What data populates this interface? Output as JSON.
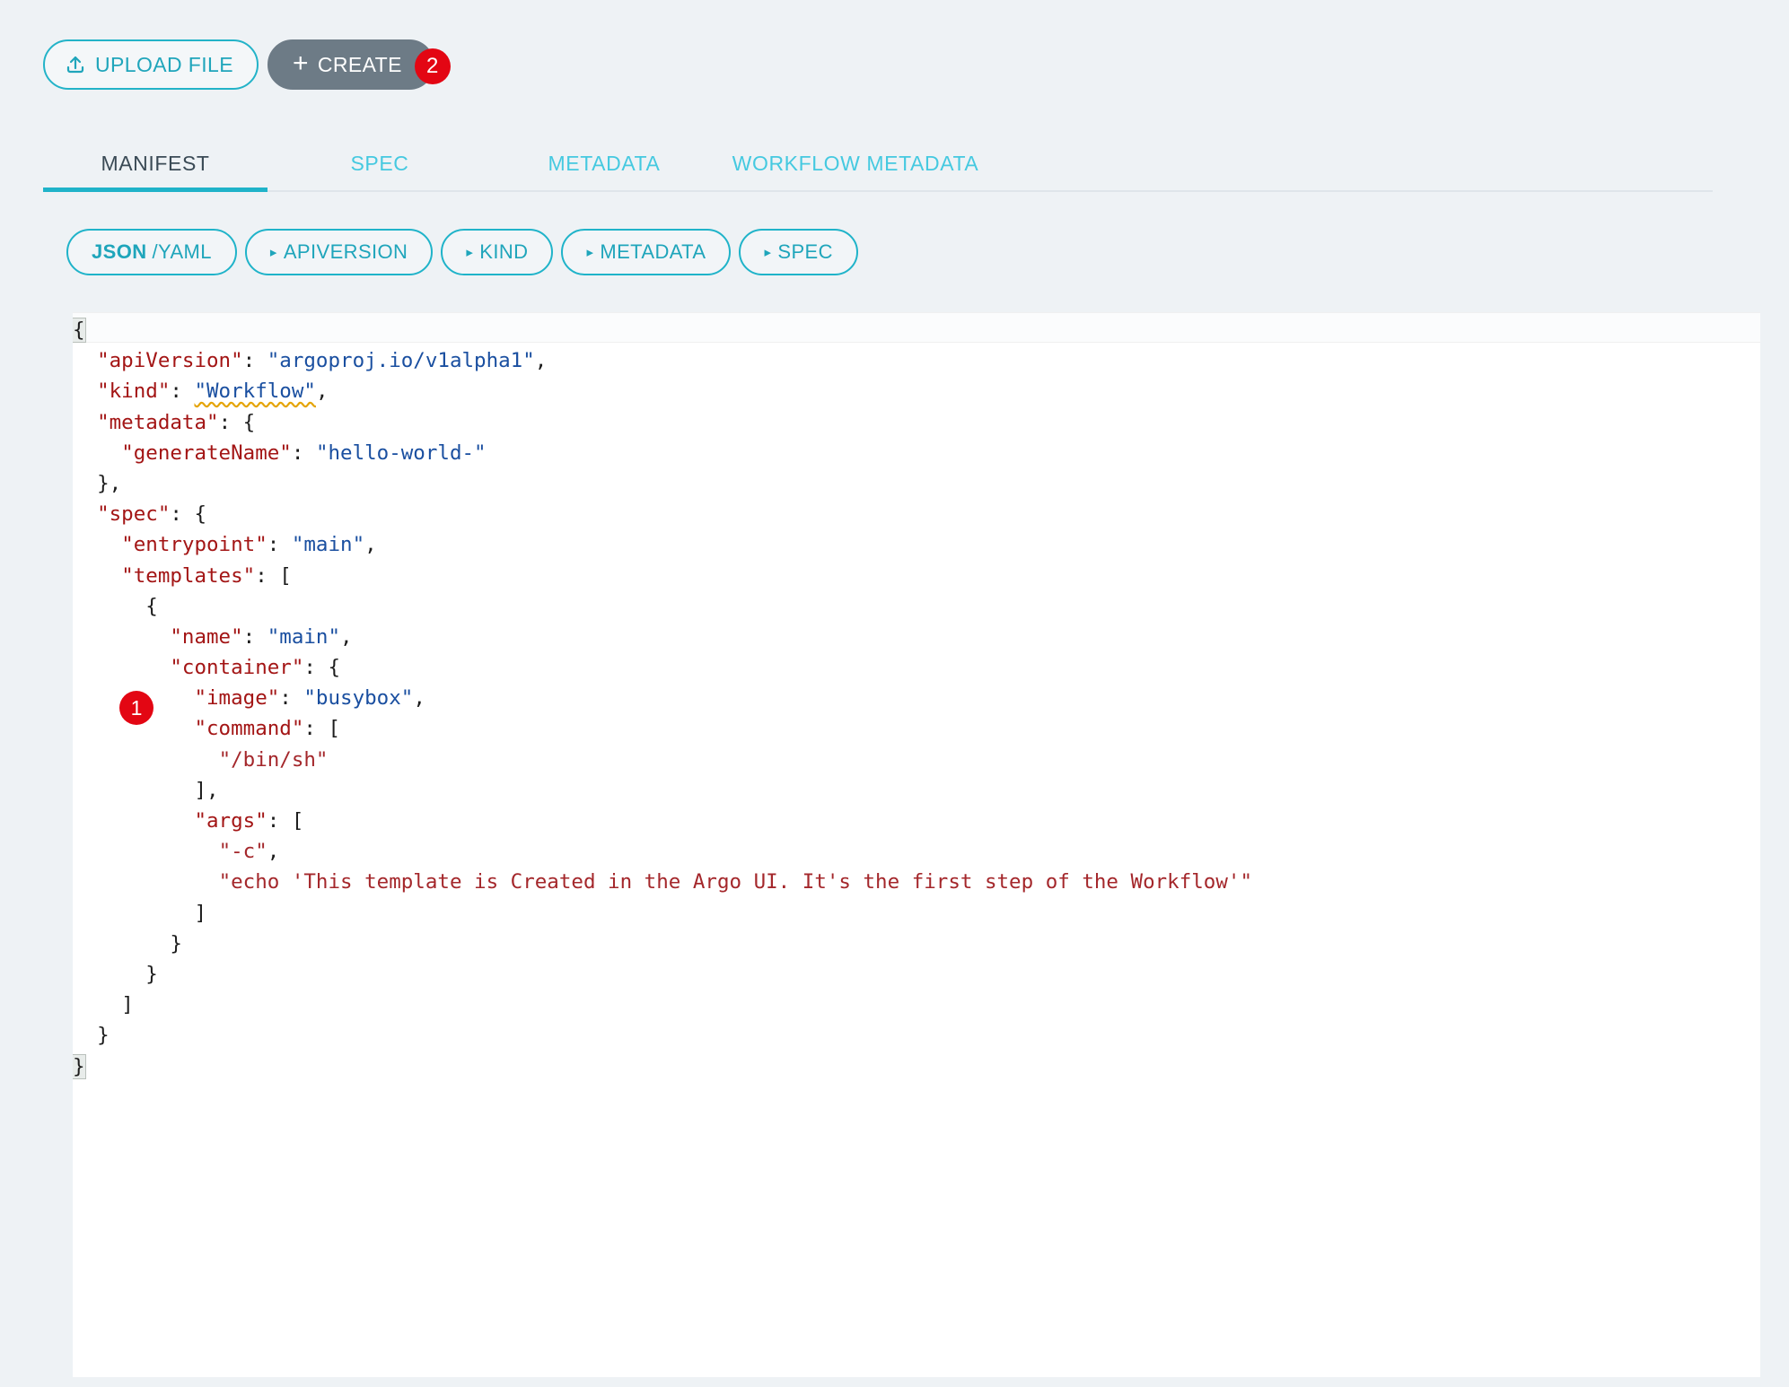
{
  "toolbar": {
    "upload_label": "UPLOAD FILE",
    "upload_icon": "upload-icon",
    "create_label": "CREATE",
    "create_plus": "+",
    "create_badge": "2"
  },
  "annotations": {
    "step1_badge": "1",
    "step2_badge": "2"
  },
  "tabs": [
    {
      "label": "MANIFEST",
      "active": true
    },
    {
      "label": "SPEC",
      "active": false
    },
    {
      "label": "METADATA",
      "active": false
    },
    {
      "label": "WORKFLOW METADATA",
      "active": false
    }
  ],
  "pills": [
    {
      "label_strong": "JSON",
      "label_rest": "/YAML",
      "caret": false
    },
    {
      "label_strong": "",
      "label_rest": "APIVERSION",
      "caret": true
    },
    {
      "label_strong": "",
      "label_rest": "KIND",
      "caret": true
    },
    {
      "label_strong": "",
      "label_rest": "METADATA",
      "caret": true
    },
    {
      "label_strong": "",
      "label_rest": "SPEC",
      "caret": true
    }
  ],
  "caret_glyph": "▸",
  "colors": {
    "accent": "#1fb3c9",
    "accent_text": "#1fa5bb",
    "create_bg": "#6d7b86",
    "badge_red": "#e30613",
    "page_bg": "#eef2f5",
    "json_key": "#a31515",
    "json_string": "#1a4fa0",
    "json_array_string": "#a4272b",
    "tab_active_text": "#3a4a55",
    "tab_inactive_text": "#45c9e0"
  },
  "editor": {
    "language": "json",
    "lines": [
      {
        "indent": 0,
        "tokens": [
          {
            "t": "{",
            "c": "p",
            "hl": true
          }
        ]
      },
      {
        "indent": 1,
        "tokens": [
          {
            "t": "\"apiVersion\"",
            "c": "k"
          },
          {
            "t": ": ",
            "c": "p"
          },
          {
            "t": "\"argoproj.io/v1alpha1\"",
            "c": "s"
          },
          {
            "t": ",",
            "c": "p"
          }
        ]
      },
      {
        "indent": 1,
        "tokens": [
          {
            "t": "\"kind\"",
            "c": "k"
          },
          {
            "t": ": ",
            "c": "p"
          },
          {
            "t": "\"Workflow\"",
            "c": "s",
            "squiggle": true
          },
          {
            "t": ",",
            "c": "p"
          }
        ]
      },
      {
        "indent": 1,
        "tokens": [
          {
            "t": "\"metadata\"",
            "c": "k"
          },
          {
            "t": ": {",
            "c": "p"
          }
        ]
      },
      {
        "indent": 2,
        "tokens": [
          {
            "t": "\"generateName\"",
            "c": "k"
          },
          {
            "t": ": ",
            "c": "p"
          },
          {
            "t": "\"hello-world-\"",
            "c": "s"
          }
        ]
      },
      {
        "indent": 1,
        "tokens": [
          {
            "t": "},",
            "c": "p"
          }
        ]
      },
      {
        "indent": 1,
        "tokens": [
          {
            "t": "\"spec\"",
            "c": "k"
          },
          {
            "t": ": {",
            "c": "p"
          }
        ]
      },
      {
        "indent": 2,
        "tokens": [
          {
            "t": "\"entrypoint\"",
            "c": "k"
          },
          {
            "t": ": ",
            "c": "p"
          },
          {
            "t": "\"main\"",
            "c": "s"
          },
          {
            "t": ",",
            "c": "p"
          }
        ]
      },
      {
        "indent": 2,
        "tokens": [
          {
            "t": "\"templates\"",
            "c": "k"
          },
          {
            "t": ": [",
            "c": "p"
          }
        ]
      },
      {
        "indent": 3,
        "tokens": [
          {
            "t": "{",
            "c": "p"
          }
        ]
      },
      {
        "indent": 4,
        "tokens": [
          {
            "t": "\"name\"",
            "c": "k"
          },
          {
            "t": ": ",
            "c": "p"
          },
          {
            "t": "\"main\"",
            "c": "s"
          },
          {
            "t": ",",
            "c": "p"
          }
        ]
      },
      {
        "indent": 4,
        "tokens": [
          {
            "t": "\"container\"",
            "c": "k"
          },
          {
            "t": ": {",
            "c": "p"
          }
        ]
      },
      {
        "indent": 5,
        "tokens": [
          {
            "t": "\"image\"",
            "c": "k"
          },
          {
            "t": ": ",
            "c": "p"
          },
          {
            "t": "\"busybox\"",
            "c": "s"
          },
          {
            "t": ",",
            "c": "p"
          }
        ]
      },
      {
        "indent": 5,
        "tokens": [
          {
            "t": "\"command\"",
            "c": "k"
          },
          {
            "t": ": [",
            "c": "p"
          }
        ]
      },
      {
        "indent": 6,
        "tokens": [
          {
            "t": "\"/bin/sh\"",
            "c": "sa"
          }
        ]
      },
      {
        "indent": 5,
        "tokens": [
          {
            "t": "],",
            "c": "p"
          }
        ]
      },
      {
        "indent": 5,
        "tokens": [
          {
            "t": "\"args\"",
            "c": "k"
          },
          {
            "t": ": [",
            "c": "p"
          }
        ]
      },
      {
        "indent": 6,
        "tokens": [
          {
            "t": "\"-c\"",
            "c": "sa"
          },
          {
            "t": ",",
            "c": "p"
          }
        ]
      },
      {
        "indent": 6,
        "tokens": [
          {
            "t": "\"echo 'This template is Created in the Argo UI. It's the first step of the Workflow'\"",
            "c": "sa"
          }
        ]
      },
      {
        "indent": 5,
        "tokens": [
          {
            "t": "]",
            "c": "p"
          }
        ]
      },
      {
        "indent": 4,
        "tokens": [
          {
            "t": "}",
            "c": "p"
          }
        ]
      },
      {
        "indent": 3,
        "tokens": [
          {
            "t": "}",
            "c": "p"
          }
        ]
      },
      {
        "indent": 2,
        "tokens": [
          {
            "t": "]",
            "c": "p"
          }
        ]
      },
      {
        "indent": 1,
        "tokens": [
          {
            "t": "}",
            "c": "p"
          }
        ]
      },
      {
        "indent": 0,
        "tokens": [
          {
            "t": "}",
            "c": "p",
            "hl": true
          }
        ]
      }
    ]
  }
}
